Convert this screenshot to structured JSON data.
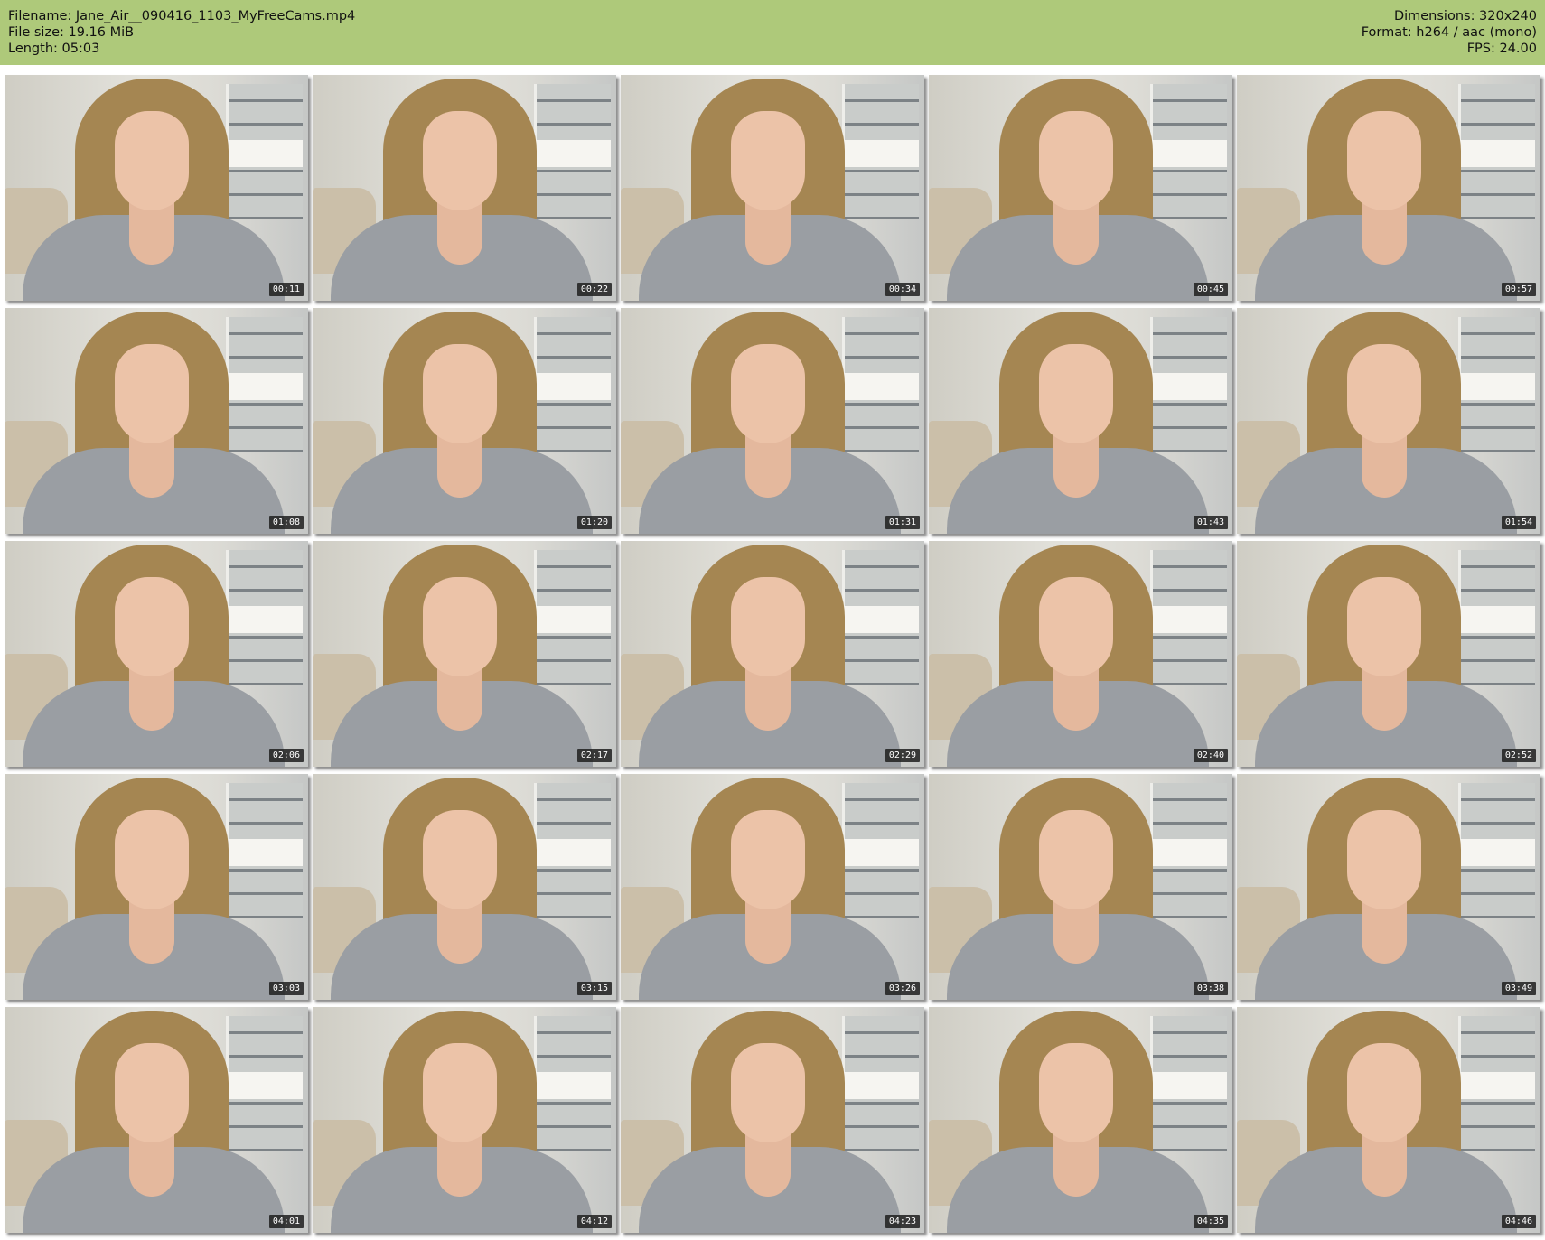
{
  "header": {
    "filename": "Filename: Jane_Air__090416_1103_MyFreeCams.mp4",
    "filesize": "File size: 19.16 MiB",
    "length": "Length: 05:03",
    "dimensions": "Dimensions: 320x240",
    "format": "Format: h264 / aac (mono)",
    "fps": "FPS: 24.00",
    "background_color": "#aec97a"
  },
  "thumbnails": [
    {
      "timestamp": "00:11"
    },
    {
      "timestamp": "00:22"
    },
    {
      "timestamp": "00:34"
    },
    {
      "timestamp": "00:45"
    },
    {
      "timestamp": "00:57"
    },
    {
      "timestamp": "01:08"
    },
    {
      "timestamp": "01:20"
    },
    {
      "timestamp": "01:31"
    },
    {
      "timestamp": "01:43"
    },
    {
      "timestamp": "01:54"
    },
    {
      "timestamp": "02:06"
    },
    {
      "timestamp": "02:17"
    },
    {
      "timestamp": "02:29"
    },
    {
      "timestamp": "02:40"
    },
    {
      "timestamp": "02:52"
    },
    {
      "timestamp": "03:03"
    },
    {
      "timestamp": "03:15"
    },
    {
      "timestamp": "03:26"
    },
    {
      "timestamp": "03:38"
    },
    {
      "timestamp": "03:49"
    },
    {
      "timestamp": "04:01"
    },
    {
      "timestamp": "04:12"
    },
    {
      "timestamp": "04:23"
    },
    {
      "timestamp": "04:35"
    },
    {
      "timestamp": "04:46"
    }
  ]
}
